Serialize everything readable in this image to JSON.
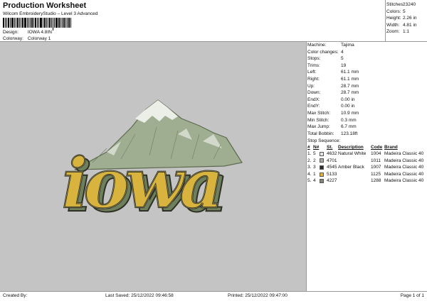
{
  "header": {
    "title": "Production Worksheet",
    "subtitle": "Wilcom EmbroideryStudio – Level 3 Advanced",
    "design_label": "Design:",
    "design_value": "IOWA 4.8IN",
    "colorway_label": "Colorway:",
    "colorway_value": "Colorway 1"
  },
  "stats": {
    "stitches_label": "Stitches:",
    "stitches": "23240",
    "colors_label": "Colors:",
    "colors": "5",
    "height_label": "Height:",
    "height": "2.26 in",
    "width_label": "Width:",
    "width": "4.81 in",
    "zoom_label": "Zoom:",
    "zoom": "1:1"
  },
  "machine_info": [
    {
      "label": "Machine:",
      "value": "Tajima"
    },
    {
      "label": "Color changes:",
      "value": "4"
    },
    {
      "label": "Stops:",
      "value": "5"
    },
    {
      "label": "Trims:",
      "value": "19"
    },
    {
      "label": "Left:",
      "value": "61.1 mm"
    },
    {
      "label": "Right:",
      "value": "61.1 mm"
    },
    {
      "label": "Up:",
      "value": "28.7 mm"
    },
    {
      "label": "Down:",
      "value": "28.7 mm"
    },
    {
      "label": "EndX:",
      "value": "0.00 in"
    },
    {
      "label": "EndY:",
      "value": "0.00 in"
    },
    {
      "label": "Max Stitch:",
      "value": "10.9 mm"
    },
    {
      "label": "Min Stitch:",
      "value": "0.3 mm"
    },
    {
      "label": "Max Jump:",
      "value": "6.7 mm"
    },
    {
      "label": "Total Bobbin:",
      "value": "123.18ft"
    }
  ],
  "stop_sequence": {
    "title": "Stop Sequence:",
    "headers": {
      "num": "#",
      "n": "N#",
      "st": "St.",
      "desc": "Description",
      "code": "Code",
      "brand": "Brand"
    },
    "rows": [
      {
        "num": "1.",
        "n": "5",
        "swatch": "#e6e6e6",
        "st": "4632",
        "desc": "Natural White",
        "code": "1004",
        "brand": "Madeira Classic 40"
      },
      {
        "num": "2.",
        "n": "2",
        "swatch": "#a9aca3",
        "st": "4701",
        "desc": "",
        "code": "1011",
        "brand": "Madeira Classic 40"
      },
      {
        "num": "3.",
        "n": "3",
        "swatch": "#2b2b2b",
        "st": "4545",
        "desc": "Amber Black",
        "code": "1007",
        "brand": "Madeira Classic 40"
      },
      {
        "num": "4.",
        "n": "1",
        "swatch": "#e2b13c",
        "st": "5133",
        "desc": "",
        "code": "1125",
        "brand": "Madeira Classic 40"
      },
      {
        "num": "5.",
        "n": "4",
        "swatch": "#7d8b6c",
        "st": "4227",
        "desc": "",
        "code": "1288",
        "brand": "Madeira Classic 40"
      }
    ]
  },
  "design_preview": {
    "text": "iowa",
    "canvas_color": "#c4c4c4",
    "letter_fill": "#d8b43f",
    "outline_color": "#2e3026",
    "shadow_color": "#6d7f5c",
    "mountain_color": "#a9b89b",
    "snow_color": "#eceee8"
  },
  "footer": {
    "created_by": "Created By:",
    "last_saved": "Last Saved: 25/12/2022 09:46:58",
    "printed": "Printed: 25/12/2022 09:47:00",
    "page": "Page 1 of 1"
  }
}
